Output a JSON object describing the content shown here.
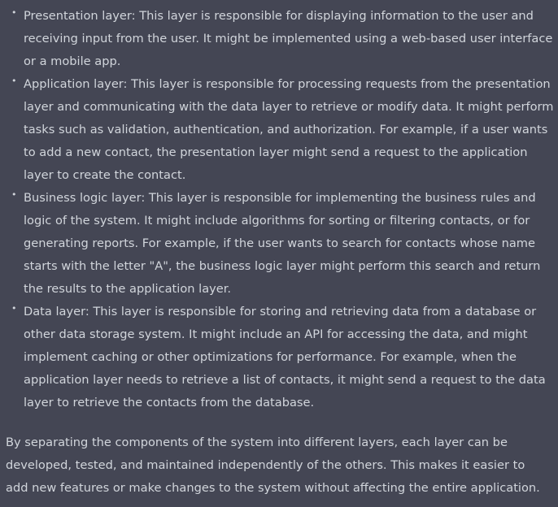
{
  "bullets": [
    {
      "marker": "•",
      "text": "Presentation layer: This layer is responsible for displaying information to the user and receiving input from the user. It might be implemented using a web-based user interface or a mobile app."
    },
    {
      "marker": "•",
      "text": "Application layer: This layer is responsible for processing requests from the presentation layer and communicating with the data layer to retrieve or modify data. It might perform tasks such as validation, authentication, and authorization. For example, if a user wants to add a new contact, the presentation layer might send a request to the application layer to create the contact."
    },
    {
      "marker": "•",
      "text": "Business logic layer: This layer is responsible for implementing the business rules and logic of the system. It might include algorithms for sorting or filtering contacts, or for generating reports. For example, if the user wants to search for contacts whose name starts with the letter \"A\", the business logic layer might perform this search and return the results to the application layer."
    },
    {
      "marker": "•",
      "text": "Data layer: This layer is responsible for storing and retrieving data from a database or other data storage system. It might include an API for accessing the data, and might implement caching or other optimizations for performance. For example, when the application layer needs to retrieve a list of contacts, it might send a request to the data layer to retrieve the contacts from the database."
    }
  ],
  "summary": "By separating the components of the system into different layers, each layer can be developed, tested, and maintained independently of the others. This makes it easier to add new features or make changes to the system without affecting the entire application.",
  "colors": {
    "background": "#444654",
    "text": "#d1d5db"
  }
}
